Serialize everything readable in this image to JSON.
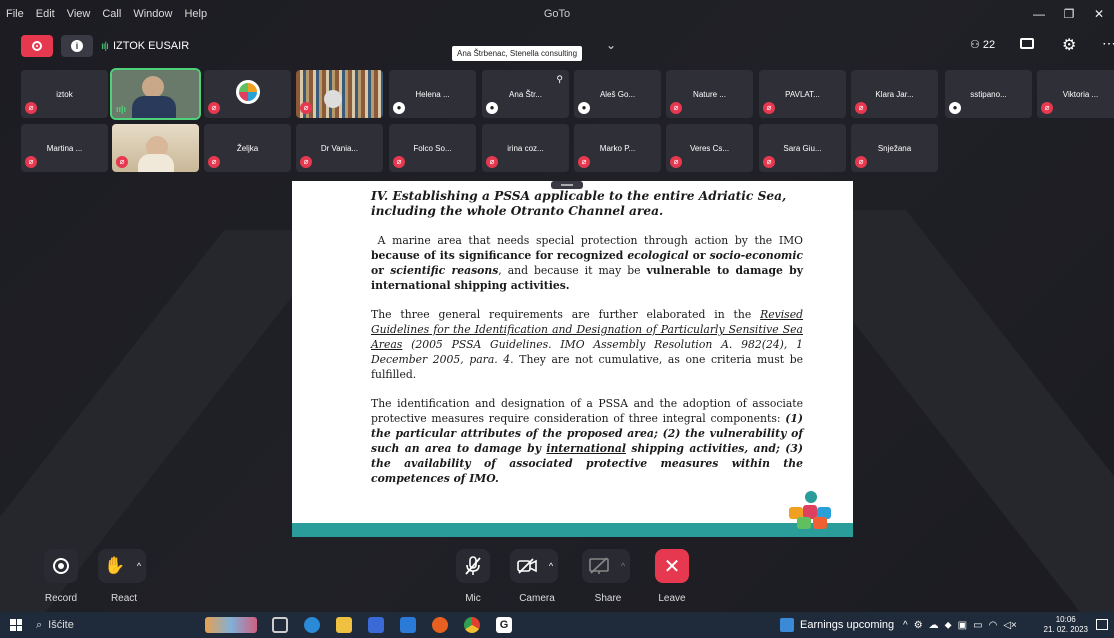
{
  "menubar": {
    "items": [
      "File",
      "Edit",
      "View",
      "Call",
      "Window",
      "Help"
    ],
    "title": "GoTo"
  },
  "topbar": {
    "meeting_name": "IZTOK EUSAIR",
    "tooltip": "Ana Štrbenac, Stenella consulting",
    "participant_count": "22"
  },
  "participants": [
    {
      "name": "iztok",
      "status": "muted"
    },
    {
      "name": "",
      "status": "speaking",
      "kind": "video"
    },
    {
      "name": "",
      "status": "muted",
      "kind": "logo"
    },
    {
      "name": "",
      "status": "muted",
      "kind": "books"
    },
    {
      "name": "Helena ...",
      "status": "mic"
    },
    {
      "name": "Ana Štr...",
      "status": "mic",
      "pinned": true
    },
    {
      "name": "Aleš Go...",
      "status": "mic"
    },
    {
      "name": "Nature ...",
      "status": "muted"
    },
    {
      "name": "PAVLAT...",
      "status": "muted"
    },
    {
      "name": "Klara Jar...",
      "status": "muted"
    },
    {
      "name": "sstipano...",
      "status": "mic"
    },
    {
      "name": "Viktoria ...",
      "status": "muted"
    },
    {
      "name": "Martina ...",
      "status": "muted"
    },
    {
      "name": "",
      "status": "muted",
      "kind": "room"
    },
    {
      "name": "Željka",
      "status": "muted"
    },
    {
      "name": "Dr Vania...",
      "status": "muted"
    },
    {
      "name": "Folco So...",
      "status": "muted"
    },
    {
      "name": "irina coz...",
      "status": "muted"
    },
    {
      "name": "Marko P...",
      "status": "muted"
    },
    {
      "name": "Veres Cs...",
      "status": "muted"
    },
    {
      "name": "Sara Giu...",
      "status": "muted"
    },
    {
      "name": "Snježana",
      "status": "muted"
    }
  ],
  "document": {
    "heading_line1": "IV. Establishing a PSSA applicable to the entire Adriatic Sea,",
    "heading_line2": "including the whole Otranto Channel area.",
    "p1_a": "A marine area that needs special protection through action by the IMO ",
    "p1_b": "because of its significance for recognized ",
    "p1_c": "ecological",
    "p1_d": " or ",
    "p1_e": "socio-economic",
    "p1_f": " or ",
    "p1_g": "scientific reasons",
    "p1_h": ", and because it may be ",
    "p1_i": "vulnerable to damage by international shipping activities.",
    "p2_a": "The three general requirements are further elaborated in the ",
    "p2_b": "Revised Guidelines for the Identification and Designation of Particularly Sensitive Sea Areas",
    "p2_c": " (2005 PSSA Guidelines. IMO Assembly Resolution A. 982(24), 1 December 2005, para. 4.",
    "p2_d": " They are not cumulative, as one criteria must be fulfilled.",
    "p3_a": "The identification and designation of a PSSA and the adoption of associate protective measures require consideration of three integral components: ",
    "p3_b": "(1) the particular attributes of the proposed area; (2) the vulnerability of such an area to damage by ",
    "p3_c": "international",
    "p3_d": " shipping activities, and; (3) the availability of associated protective measures within the competences of IMO."
  },
  "controls": {
    "record": "Record",
    "react": "React",
    "mic": "Mic",
    "camera": "Camera",
    "share": "Share",
    "leave": "Leave"
  },
  "taskbar": {
    "search_placeholder": "Išćite",
    "news": "Earnings upcoming",
    "time": "10:06",
    "date": "21. 02. 2023"
  },
  "colors": {
    "accent_red": "#e63950",
    "speaking_green": "#4fd17a",
    "doc_teal": "#2a9d9a"
  }
}
